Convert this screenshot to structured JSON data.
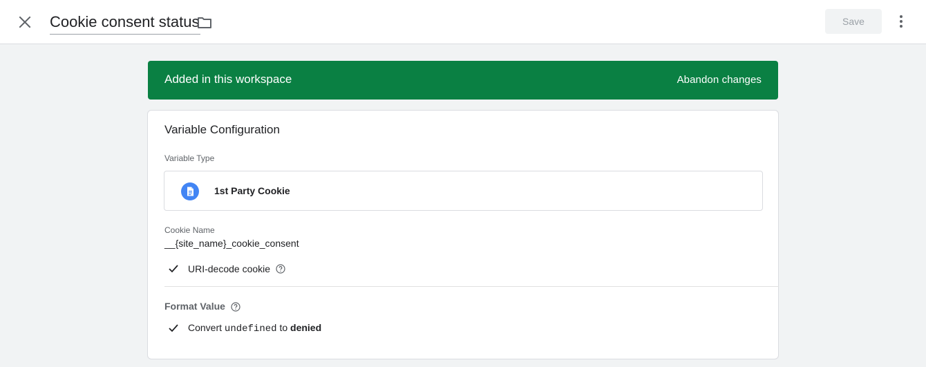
{
  "header": {
    "title": "Cookie consent status",
    "save_label": "Save"
  },
  "banner": {
    "message": "Added in this workspace",
    "action": "Abandon changes",
    "color": "#0a8043"
  },
  "config": {
    "title": "Variable Configuration",
    "type_label": "Variable Type",
    "type_value": "1st Party Cookie",
    "cookie_name_label": "Cookie Name",
    "cookie_name_value": "__{site_name}_cookie_consent",
    "uri_decode_label": "URI-decode cookie",
    "format_value_label": "Format Value",
    "convert_prefix": "Convert",
    "convert_code": "undefined",
    "convert_mid": "to",
    "convert_target": "denied"
  },
  "icons": {
    "close": "close-icon",
    "folder": "folder-icon",
    "more": "more-vert-icon",
    "doc": "document-icon",
    "check": "check-icon",
    "help": "help-icon"
  }
}
